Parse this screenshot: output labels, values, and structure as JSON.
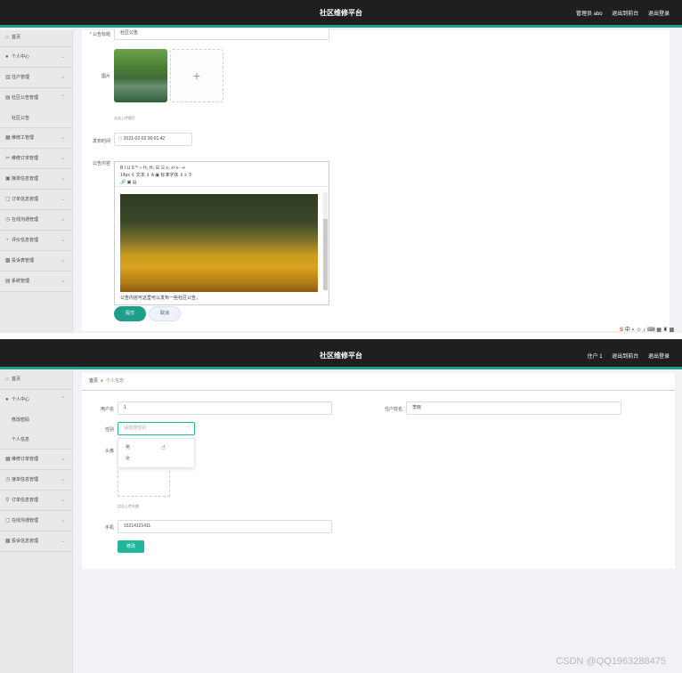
{
  "screen1": {
    "header": {
      "title": "社区维修平台",
      "user": "管理员 abo",
      "exit_backend": "退出到前台",
      "logout": "退出登录"
    },
    "sidebar": [
      {
        "icon": "home-icon",
        "label": "首页"
      },
      {
        "icon": "person-icon",
        "label": "个人中心"
      },
      {
        "icon": "building-icon",
        "label": "住户管理"
      },
      {
        "icon": "announcement-icon",
        "label": "社区公告管理",
        "expanded": true
      },
      {
        "icon": "",
        "label": "社区公告",
        "sub": true
      },
      {
        "icon": "wrench-icon",
        "label": "维修工管理"
      },
      {
        "icon": "tools-icon",
        "label": "维修订单管理"
      },
      {
        "icon": "report-icon",
        "label": "接单信息管理"
      },
      {
        "icon": "order-icon",
        "label": "订单信息管理"
      },
      {
        "icon": "clock-icon",
        "label": "在线沟通管理"
      },
      {
        "icon": "evaluation-icon",
        "label": "评价信息管理"
      },
      {
        "icon": "feedback-icon",
        "label": "投诉表管理"
      },
      {
        "icon": "system-icon",
        "label": "系统管理"
      }
    ],
    "form": {
      "title_label": "* 公告标题",
      "title_value": "社区公告",
      "image_label": "图片",
      "upload_hint": "点击上传图片",
      "time_label": "发布时间",
      "time_value": "2021-02-02 00:01:42",
      "content_label": "公告内容",
      "toolbar_row1": "B  I  U  S   ❞  ‹›   H₁  H₂   ☰  ☷   x₂  x²   ⇤  ⇥",
      "toolbar_row2": "14px  ⇕    文本  ⇕    A  ▣    标准字体  ⇕   ≡   T̷",
      "toolbar_row3": "🔗  ▣  ▤",
      "content_text": "公告内容可这里可以发布一些社区公告；",
      "submit": "提交",
      "cancel": "取消"
    },
    "taskbar": "中 ⸰ ☺ ♪ ⌨ ▦ ♜ ▩"
  },
  "screen2": {
    "header": {
      "title": "社区维修平台",
      "user": "住户 1",
      "exit_backend": "退出到前台",
      "logout": "退出登录"
    },
    "breadcrumb": {
      "home": "首页",
      "current": "个人信息"
    },
    "sidebar": [
      {
        "icon": "home-icon",
        "label": "首页"
      },
      {
        "icon": "person-icon",
        "label": "个人中心",
        "expanded": true
      },
      {
        "icon": "",
        "label": "修改密码",
        "sub": true
      },
      {
        "icon": "",
        "label": "个人信息",
        "sub": true
      },
      {
        "icon": "tools-icon",
        "label": "维修订单管理"
      },
      {
        "icon": "clock-icon",
        "label": "接单信息管理"
      },
      {
        "icon": "pin-icon",
        "label": "订单信息管理"
      },
      {
        "icon": "chat-icon",
        "label": "在线沟通管理"
      },
      {
        "icon": "feedback-icon",
        "label": "投诉信息管理"
      }
    ],
    "form": {
      "username_label": "用户名",
      "username_value": "1",
      "name_label": "住户姓名",
      "name_value": "李晓",
      "gender_label": "性别",
      "gender_placeholder": "请选择性别",
      "gender_options": [
        "男",
        "女"
      ],
      "avatar_label": "头像",
      "avatar_hint": "点击上传头像",
      "phone_label": "手机",
      "phone_value": "15214121411",
      "save": "修改"
    },
    "watermark": "CSDN @QQ1963288475"
  }
}
